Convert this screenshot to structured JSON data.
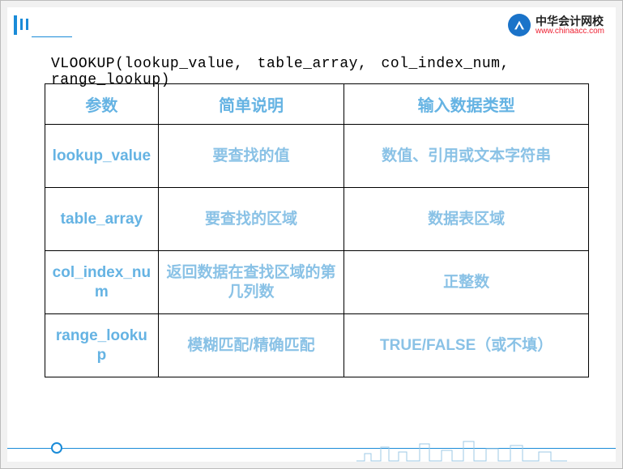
{
  "brand": {
    "name": "中华会计网校",
    "url": "www.chinaacc.com"
  },
  "formula": "VLOOKUP(lookup_value,  table_array,   col_index_num,  range_lookup)",
  "table": {
    "headers": [
      "参数",
      "简单说明",
      "输入数据类型"
    ],
    "rows": [
      {
        "param": "lookup_value",
        "desc": "要查找的值",
        "type": "数值、引用或文本字符串"
      },
      {
        "param": "table_array",
        "desc": "要查找的区域",
        "type": "数据表区域"
      },
      {
        "param": "col_index_num",
        "desc": "返回数据在查找区域的第几列数",
        "type": "正整数"
      },
      {
        "param": "range_lookup",
        "desc": "模糊匹配/精确匹配",
        "type": "TRUE/FALSE（或不填）"
      }
    ]
  },
  "chart_data": {
    "type": "table",
    "title": "VLOOKUP 函数参数说明",
    "columns": [
      "参数",
      "简单说明",
      "输入数据类型"
    ],
    "rows": [
      [
        "lookup_value",
        "要查找的值",
        "数值、引用或文本字符串"
      ],
      [
        "table_array",
        "要查找的区域",
        "数据表区域"
      ],
      [
        "col_index_num",
        "返回数据在查找区域的第几列数",
        "正整数"
      ],
      [
        "range_lookup",
        "模糊匹配/精确匹配",
        "TRUE/FALSE（或不填）"
      ]
    ]
  }
}
